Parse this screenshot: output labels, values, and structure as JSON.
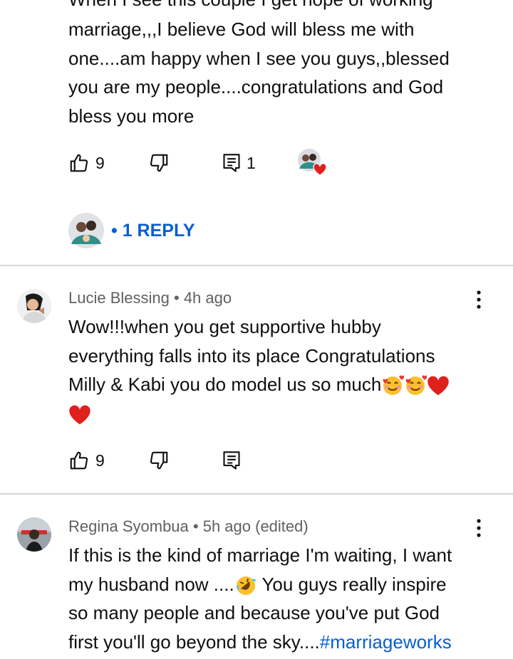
{
  "comment1": {
    "top_partial_line": "When I see this couple I get hope of working",
    "lines": [
      "marriage,,,I believe God will bless me with",
      "one....am happy when I see you guys,,blessed",
      "you are my people....congratulations and God",
      "bless you more"
    ],
    "like_count": "9",
    "reply_count": "1",
    "replies_label": "• 1 REPLY"
  },
  "comment2": {
    "author": "Lucie Blessing",
    "time": "• 4h ago",
    "lines": [
      "Wow!!!when you get supportive hubby",
      "everything falls into its place Congratulations",
      "Milly & Kabi you do model us so much"
    ],
    "like_count": "9"
  },
  "comment3": {
    "author": "Regina Syombua",
    "time": "• 5h ago (edited)",
    "line1": "If this is the kind of marriage I'm waiting, I want",
    "line2_start": "my husband now ....",
    "line2_end": " You guys really inspire",
    "line3": "so many people and because you've put God",
    "line4_start": "first you'll go beyond the sky....",
    "hashtag": "#marriageworks"
  },
  "icons": [
    "thumbs-up-icon",
    "thumbs-down-icon",
    "reply-icon",
    "more-vert-icon",
    "heart-icon",
    "smiling-hearts-emoji",
    "rolling-laughing-emoji"
  ],
  "colors": {
    "link": "#065fd4",
    "meta": "#606060",
    "divider": "#d6d6d6",
    "heart": "#e0201c"
  }
}
